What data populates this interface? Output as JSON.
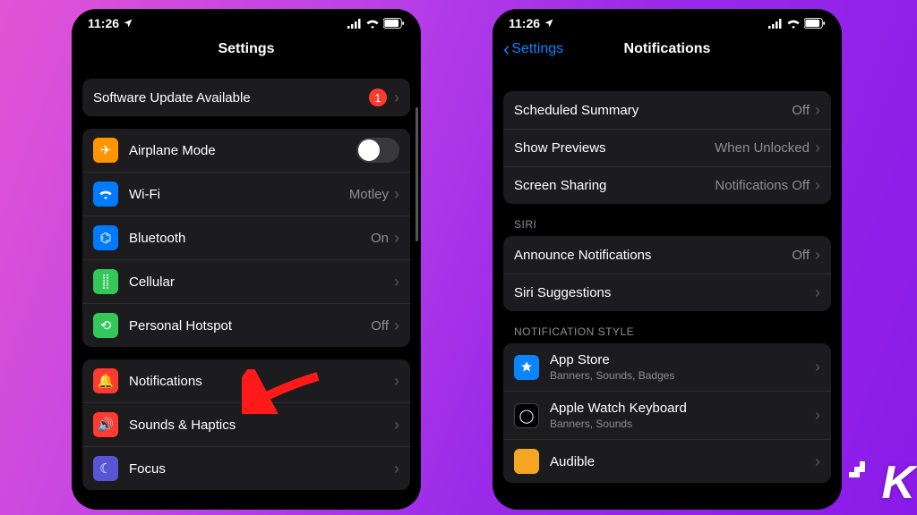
{
  "statusbar": {
    "time": "11:26"
  },
  "phone1": {
    "title": "Settings",
    "software": {
      "label": "Software Update Available",
      "badge": "1"
    },
    "rows": {
      "airplane": "Airplane Mode",
      "wifi": "Wi-Fi",
      "wifi_val": "Motley",
      "bt": "Bluetooth",
      "bt_val": "On",
      "cell": "Cellular",
      "hotspot": "Personal Hotspot",
      "hotspot_val": "Off",
      "notif": "Notifications",
      "sounds": "Sounds & Haptics",
      "focus": "Focus"
    }
  },
  "phone2": {
    "back": "Settings",
    "title": "Notifications",
    "rows": {
      "sched": "Scheduled Summary",
      "sched_val": "Off",
      "prev": "Show Previews",
      "prev_val": "When Unlocked",
      "share": "Screen Sharing",
      "share_val": "Notifications Off"
    },
    "siri_head": "SIRI",
    "siri": {
      "announce": "Announce Notifications",
      "announce_val": "Off",
      "sugg": "Siri Suggestions"
    },
    "style_head": "NOTIFICATION STYLE",
    "apps": {
      "appstore": "App Store",
      "appstore_sub": "Banners, Sounds, Badges",
      "awk": "Apple Watch Keyboard",
      "awk_sub": "Banners, Sounds",
      "audible": "Audible"
    }
  }
}
